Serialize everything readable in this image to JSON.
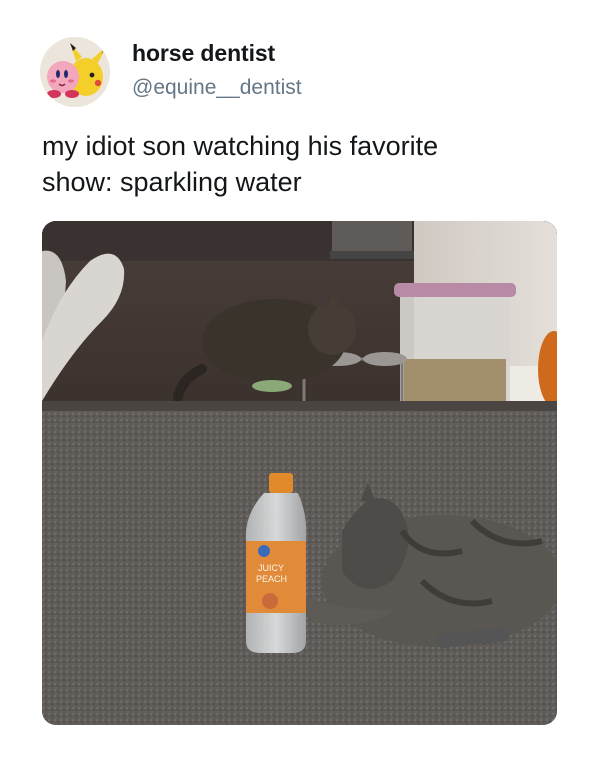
{
  "tweet": {
    "author": {
      "display_name": "horse dentist",
      "handle": "@equine__dentist",
      "avatar_icon": "kirby-pikachu-avatar-icon"
    },
    "text_lines": [
      "my idiot son watching his favorite",
      "show: sparkling water"
    ],
    "media": {
      "bottle_label_line1": "JUICY",
      "bottle_label_line2": "PEACH"
    }
  },
  "colors": {
    "display_name": "#14171a",
    "handle": "#657786",
    "background": "#ffffff"
  }
}
